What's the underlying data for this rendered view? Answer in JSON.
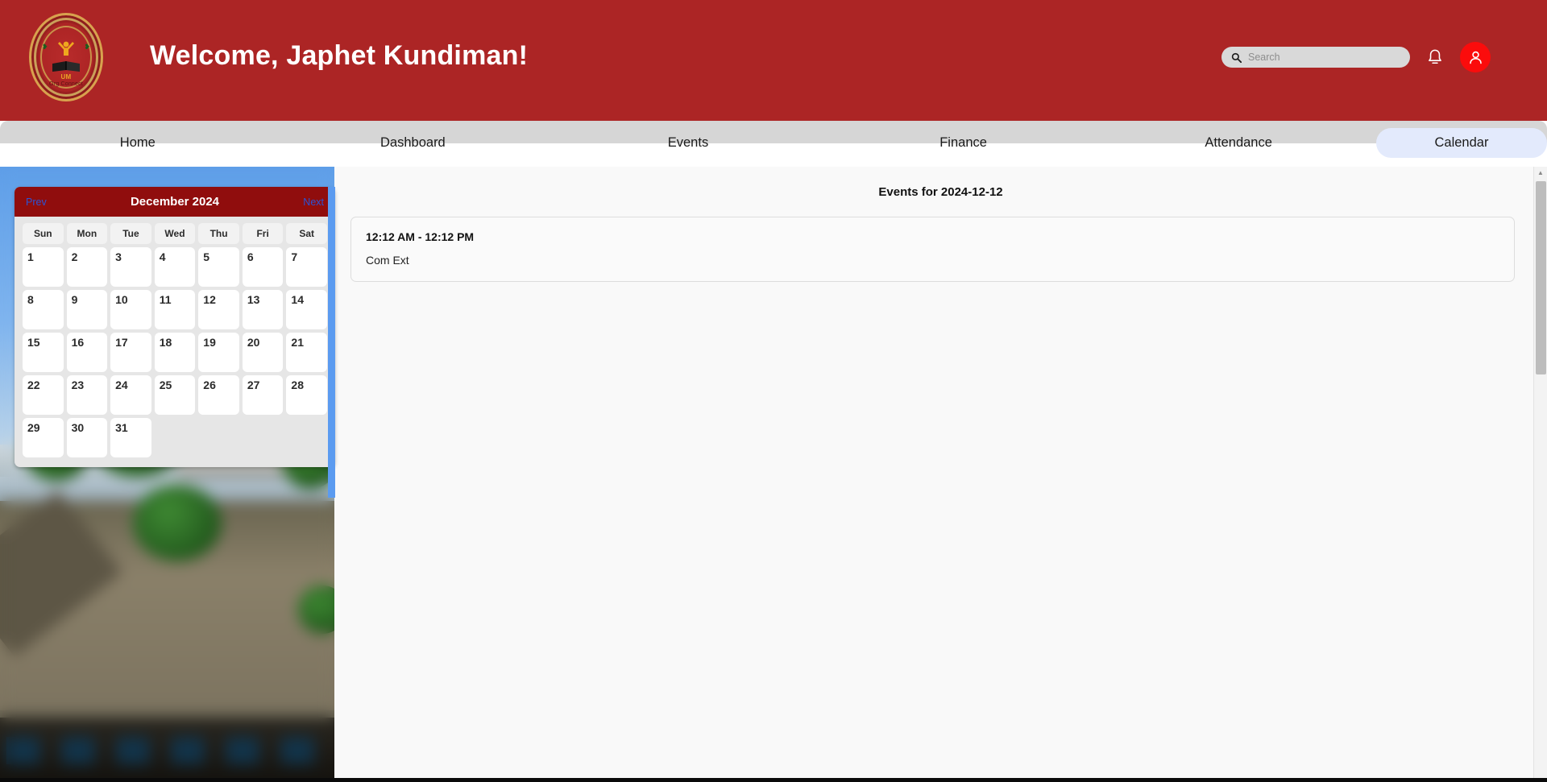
{
  "header": {
    "welcome_title": "Welcome, Japhet Kundiman!",
    "logo": {
      "org_name": "Org Connect",
      "monogram": "UM",
      "leaf_left": "❥",
      "leaf_right": "❥"
    },
    "search": {
      "placeholder": "Search",
      "value": "",
      "icon": "search-icon"
    },
    "notification_icon": "bell-icon",
    "avatar_icon": "user-avatar-icon",
    "brand_color": "#ac2525",
    "avatar_color": "#fb0c0c"
  },
  "nav": {
    "items": [
      {
        "label": "Home",
        "active": false
      },
      {
        "label": "Dashboard",
        "active": false
      },
      {
        "label": "Events",
        "active": false
      },
      {
        "label": "Finance",
        "active": false
      },
      {
        "label": "Attendance",
        "active": false
      },
      {
        "label": "Calendar",
        "active": true
      }
    ],
    "active_bg": "#e3eafc",
    "bar_bg": "#d6d6d6"
  },
  "calendar": {
    "prev_label": "Prev",
    "next_label": "Next",
    "month_label": "December 2024",
    "header_color": "#900d0d",
    "weekdays": [
      "Sun",
      "Mon",
      "Tue",
      "Wed",
      "Thu",
      "Fri",
      "Sat"
    ],
    "days": [
      "1",
      "2",
      "3",
      "4",
      "5",
      "6",
      "7",
      "8",
      "9",
      "10",
      "11",
      "12",
      "13",
      "14",
      "15",
      "16",
      "17",
      "18",
      "19",
      "20",
      "21",
      "22",
      "23",
      "24",
      "25",
      "26",
      "27",
      "28",
      "29",
      "30",
      "31",
      "",
      "",
      "",
      ""
    ],
    "scrollbar_color": "#5b9bf0"
  },
  "events": {
    "heading": "Events for 2024-12-12",
    "list": [
      {
        "time": "12:12 AM - 12:12 PM",
        "name": "Com Ext"
      }
    ]
  },
  "scrollbar": {
    "up_arrow": "▲"
  }
}
